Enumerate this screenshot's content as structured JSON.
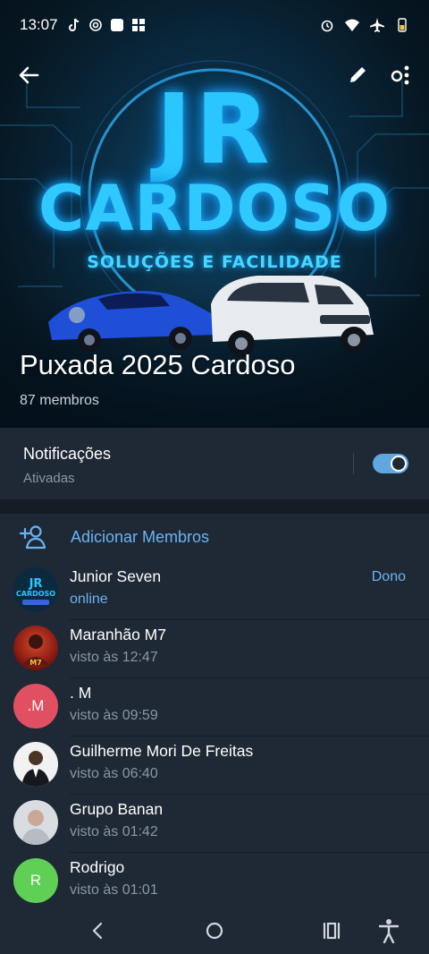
{
  "status_bar": {
    "time": "13:07",
    "left_icons": [
      "tiktok-icon",
      "spiral-icon",
      "square-app-icon",
      "windows-icon"
    ],
    "right_icons": [
      "alarm-icon",
      "wifi-icon",
      "airplane-icon",
      "battery-icon"
    ]
  },
  "header": {
    "logo": {
      "line1": "JR",
      "line2": "CARDOSO",
      "tagline": "SOLUÇÕES E FACILIDADE"
    },
    "title": "Puxada 2025 Cardoso",
    "subtitle": "87 membros"
  },
  "notifications": {
    "label": "Notificações",
    "status": "Ativadas",
    "enabled": true
  },
  "add_members": {
    "label": "Adicionar Membros"
  },
  "members": [
    {
      "name": "Junior Seven",
      "status": "online",
      "role": "Dono",
      "avatar": "logo"
    },
    {
      "name": "Maranhão M7",
      "status": "visto às 12:47",
      "role": "",
      "avatar": "photo-red"
    },
    {
      "name": ". M",
      "status": "visto às 09:59",
      "role": "",
      "avatar": "initials",
      "initials": ".M",
      "color": "#e05062"
    },
    {
      "name": "Guilherme Mori De Freitas",
      "status": "visto às 06:40",
      "role": "",
      "avatar": "photo-person"
    },
    {
      "name": "Grupo Banan",
      "status": "visto às 01:42",
      "role": "",
      "avatar": "photo-light"
    },
    {
      "name": "Rodrigo",
      "status": "visto às 01:01",
      "role": "",
      "avatar": "initials",
      "initials": "R",
      "color": "#5fcf56"
    }
  ],
  "colors": {
    "accent": "#6ab3f3",
    "background": "#1f2935",
    "separator": "#151c25"
  }
}
